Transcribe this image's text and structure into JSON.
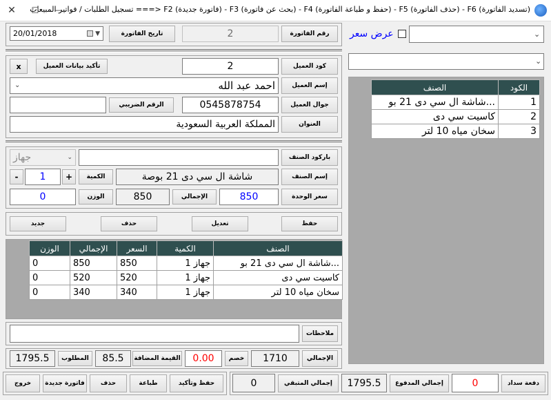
{
  "window": {
    "title": "تسجيل الطلبات / فواتير المبيعات ===> F2 (فاتورة جديدة) - F3 (بحث عن فاتورة) - F4 (حفظ و طباعة الفاتورة) - F5 (حذف الفاتورة) - F6 (تسديد الفاتورة)",
    "close_glyph": "✕",
    "maximize_glyph": "☐",
    "minimize_glyph": "—"
  },
  "invoice": {
    "number_label": "رقم الفاتورة",
    "number_value": "2",
    "date_label": "تاريخ الفاتورة",
    "date_value": "20/01/2018"
  },
  "customer": {
    "code_label": "كود العميل",
    "code_value": "2",
    "confirm_label": "تأكيد بيانات العميل",
    "clear_label": "x",
    "name_label": "إسم العميل",
    "name_value": "احمد عبد الله",
    "mobile_label": "جوال العميل",
    "mobile_value": "0545878754",
    "tax_label": "الرقم الضريبي",
    "tax_value": "",
    "address_label": "العنوان",
    "address_value": "المملكة العربية السعودية"
  },
  "item": {
    "barcode_label": "باركود الصنف",
    "barcode_value": "",
    "unit_value": "جهاز",
    "name_label": "إسم الصنف",
    "name_value": "شاشة ال سي دى 21 بوصة",
    "qty_label": "الكمية",
    "qty_value": "1",
    "qty_plus": "+",
    "qty_minus": "-",
    "unit_price_label": "سعر الوحدة",
    "unit_price_value": "850",
    "total_label": "الإجمالي",
    "total_value": "850",
    "weight_label": "الوزن",
    "weight_value": "0"
  },
  "actions": {
    "save": "حفظ",
    "edit": "تعديل",
    "delete": "حذف",
    "new": "جديد"
  },
  "lines": {
    "headers": [
      "الصنف",
      "الكمية",
      "السعر",
      "الإجمالي",
      "الوزن"
    ],
    "rows": [
      [
        "شاشة ال سي دى 21 بو...",
        "1 جهاز",
        "850",
        "850",
        "0"
      ],
      [
        "كاسيت سي دى",
        "1 جهاز",
        "520",
        "520",
        "0"
      ],
      [
        "سخان مياه 10 لتر",
        "1 جهاز",
        "340",
        "340",
        "0"
      ]
    ]
  },
  "notes": {
    "label": "ملاحظات",
    "value": ""
  },
  "totals": {
    "total_label": "الإجمالي",
    "total_value": "1710",
    "discount_label": "خصم",
    "discount_value": "0.00",
    "vat_label": "القيمة المضافة",
    "vat_value": "85.5",
    "required_label": "المطلوب",
    "required_value": "1795.5"
  },
  "footer": {
    "payment_label": "دفعة سداد",
    "payment_value": "0",
    "paid_label": "إجمالي المدفوع",
    "paid_value": "1795.5",
    "remaining_label": "إجمالي المتبقي",
    "remaining_value": "0",
    "save_confirm": "حفظ وتأكيد",
    "print": "طباعة",
    "delete": "حذف",
    "new_invoice": "فاتورة جديدة",
    "exit": "خروج"
  },
  "right_panel": {
    "show_price_label": "عرض سعر",
    "combo1_value": "",
    "combo2_value": "",
    "headers": [
      "الكود",
      "الصنف"
    ],
    "rows": [
      [
        "1",
        "شاشة ال سي دى 21 بو..."
      ],
      [
        "2",
        "كاسيت سي دى"
      ],
      [
        "3",
        "سخان مياه 10 لتر"
      ]
    ]
  },
  "icons": [
    "app-icon",
    "calendar-icon",
    "chevron-down-icon",
    "close-icon",
    "maximize-icon",
    "minimize-icon"
  ]
}
